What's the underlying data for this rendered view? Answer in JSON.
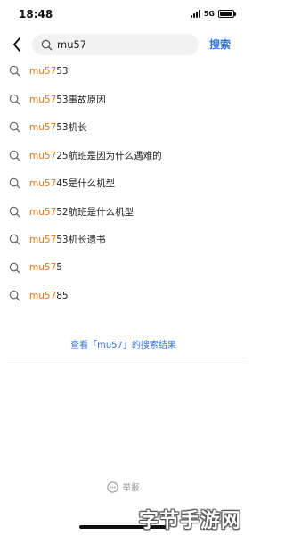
{
  "status_bar": {
    "time": "18:48",
    "network": "5G",
    "battery_level": 0.9
  },
  "search": {
    "query": "mu57",
    "submit_label": "搜索",
    "back_icon": "chevron-left-icon",
    "search_icon": "search-icon"
  },
  "suggestions": [
    {
      "highlight": "mu57",
      "rest": "53"
    },
    {
      "highlight": "mu57",
      "rest": "53事故原因"
    },
    {
      "highlight": "mu57",
      "rest": "53机长"
    },
    {
      "highlight": "mu57",
      "rest": "25航班是因为什么遇难的"
    },
    {
      "highlight": "mu57",
      "rest": "45是什么机型"
    },
    {
      "highlight": "mu57",
      "rest": "52航班是什么机型"
    },
    {
      "highlight": "mu57",
      "rest": "53机长遗书"
    },
    {
      "highlight": "mu57",
      "rest": "5"
    },
    {
      "highlight": "mu57",
      "rest": "85"
    }
  ],
  "view_all": "查看「mu57」的搜索结果",
  "report": {
    "icon": "report-icon",
    "label": "举报"
  },
  "watermark": "字节手游网",
  "colors": {
    "accent_blue": "#2f6fe0",
    "highlight_orange": "#e07a1c"
  }
}
